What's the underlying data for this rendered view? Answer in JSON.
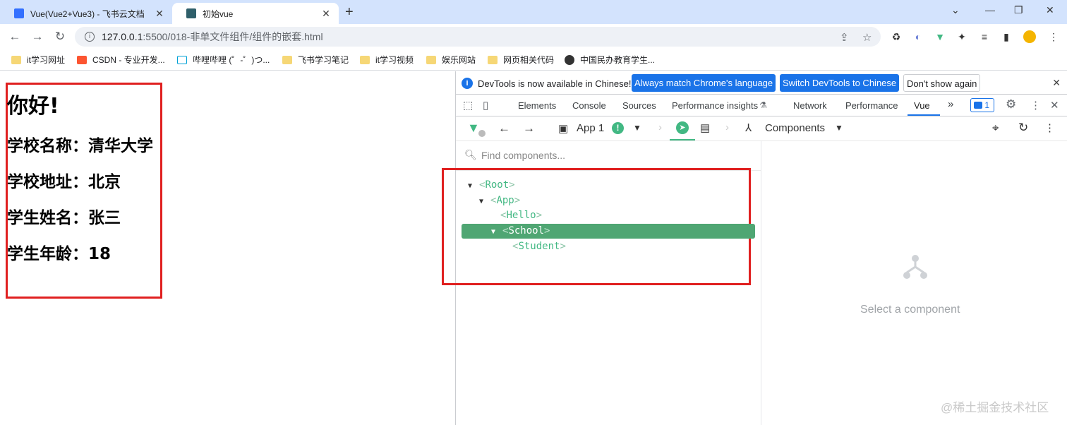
{
  "browser": {
    "tabs": [
      {
        "title": "Vue(Vue2+Vue3) - 飞书云文档",
        "active": false,
        "favicon_color": "#3370ff"
      },
      {
        "title": "初始vue",
        "active": true,
        "favicon_color": "#2f5f6a"
      }
    ],
    "new_tab": "+",
    "url": {
      "host": "127.0.0.1",
      "path": ":5500/018-非单文件组件/组件的嵌套.html"
    },
    "bookmarks": [
      {
        "label": "it学习网址",
        "icon": "folder-icon"
      },
      {
        "label": "CSDN - 专业开发...",
        "icon": "csdn-icon"
      },
      {
        "label": "哔哩哔哩 (゜-゜)つ...",
        "icon": "bilibili-icon"
      },
      {
        "label": "飞书学习笔记",
        "icon": "folder-icon"
      },
      {
        "label": "it学习视频",
        "icon": "folder-icon"
      },
      {
        "label": "娱乐网站",
        "icon": "folder-icon"
      },
      {
        "label": "网页相关代码",
        "icon": "folder-icon"
      },
      {
        "label": "中国民办教育学生...",
        "icon": "globe-icon"
      }
    ]
  },
  "page": {
    "greeting": "你好!",
    "school_name": "学校名称：清华大学",
    "school_address": "学校地址：北京",
    "student_name": "学生姓名：张三",
    "student_age": "学生年龄：18"
  },
  "devtools": {
    "infobar": {
      "message": "DevTools is now available in Chinese!",
      "btn_match": "Always match Chrome's language",
      "btn_switch": "Switch DevTools to Chinese",
      "btn_dismiss": "Don't show again"
    },
    "tabs": [
      "Elements",
      "Console",
      "Sources",
      "Performance insights",
      "Network",
      "Performance",
      "Vue"
    ],
    "active_tab": "Vue",
    "more": "»",
    "issues_count": "1",
    "vue": {
      "app_label": "App 1",
      "components_label": "Components",
      "search_placeholder": "Find components...",
      "tree": {
        "root": "Root",
        "app": "App",
        "hello": "Hello",
        "school": "School",
        "student": "Student"
      },
      "empty_text": "Select a component"
    }
  },
  "watermark": "@稀土掘金技术社区",
  "colors": {
    "accent": "#1a73e8",
    "vue_green": "#42b883",
    "selected_row": "#4fa673",
    "highlight_box": "#e02020"
  }
}
